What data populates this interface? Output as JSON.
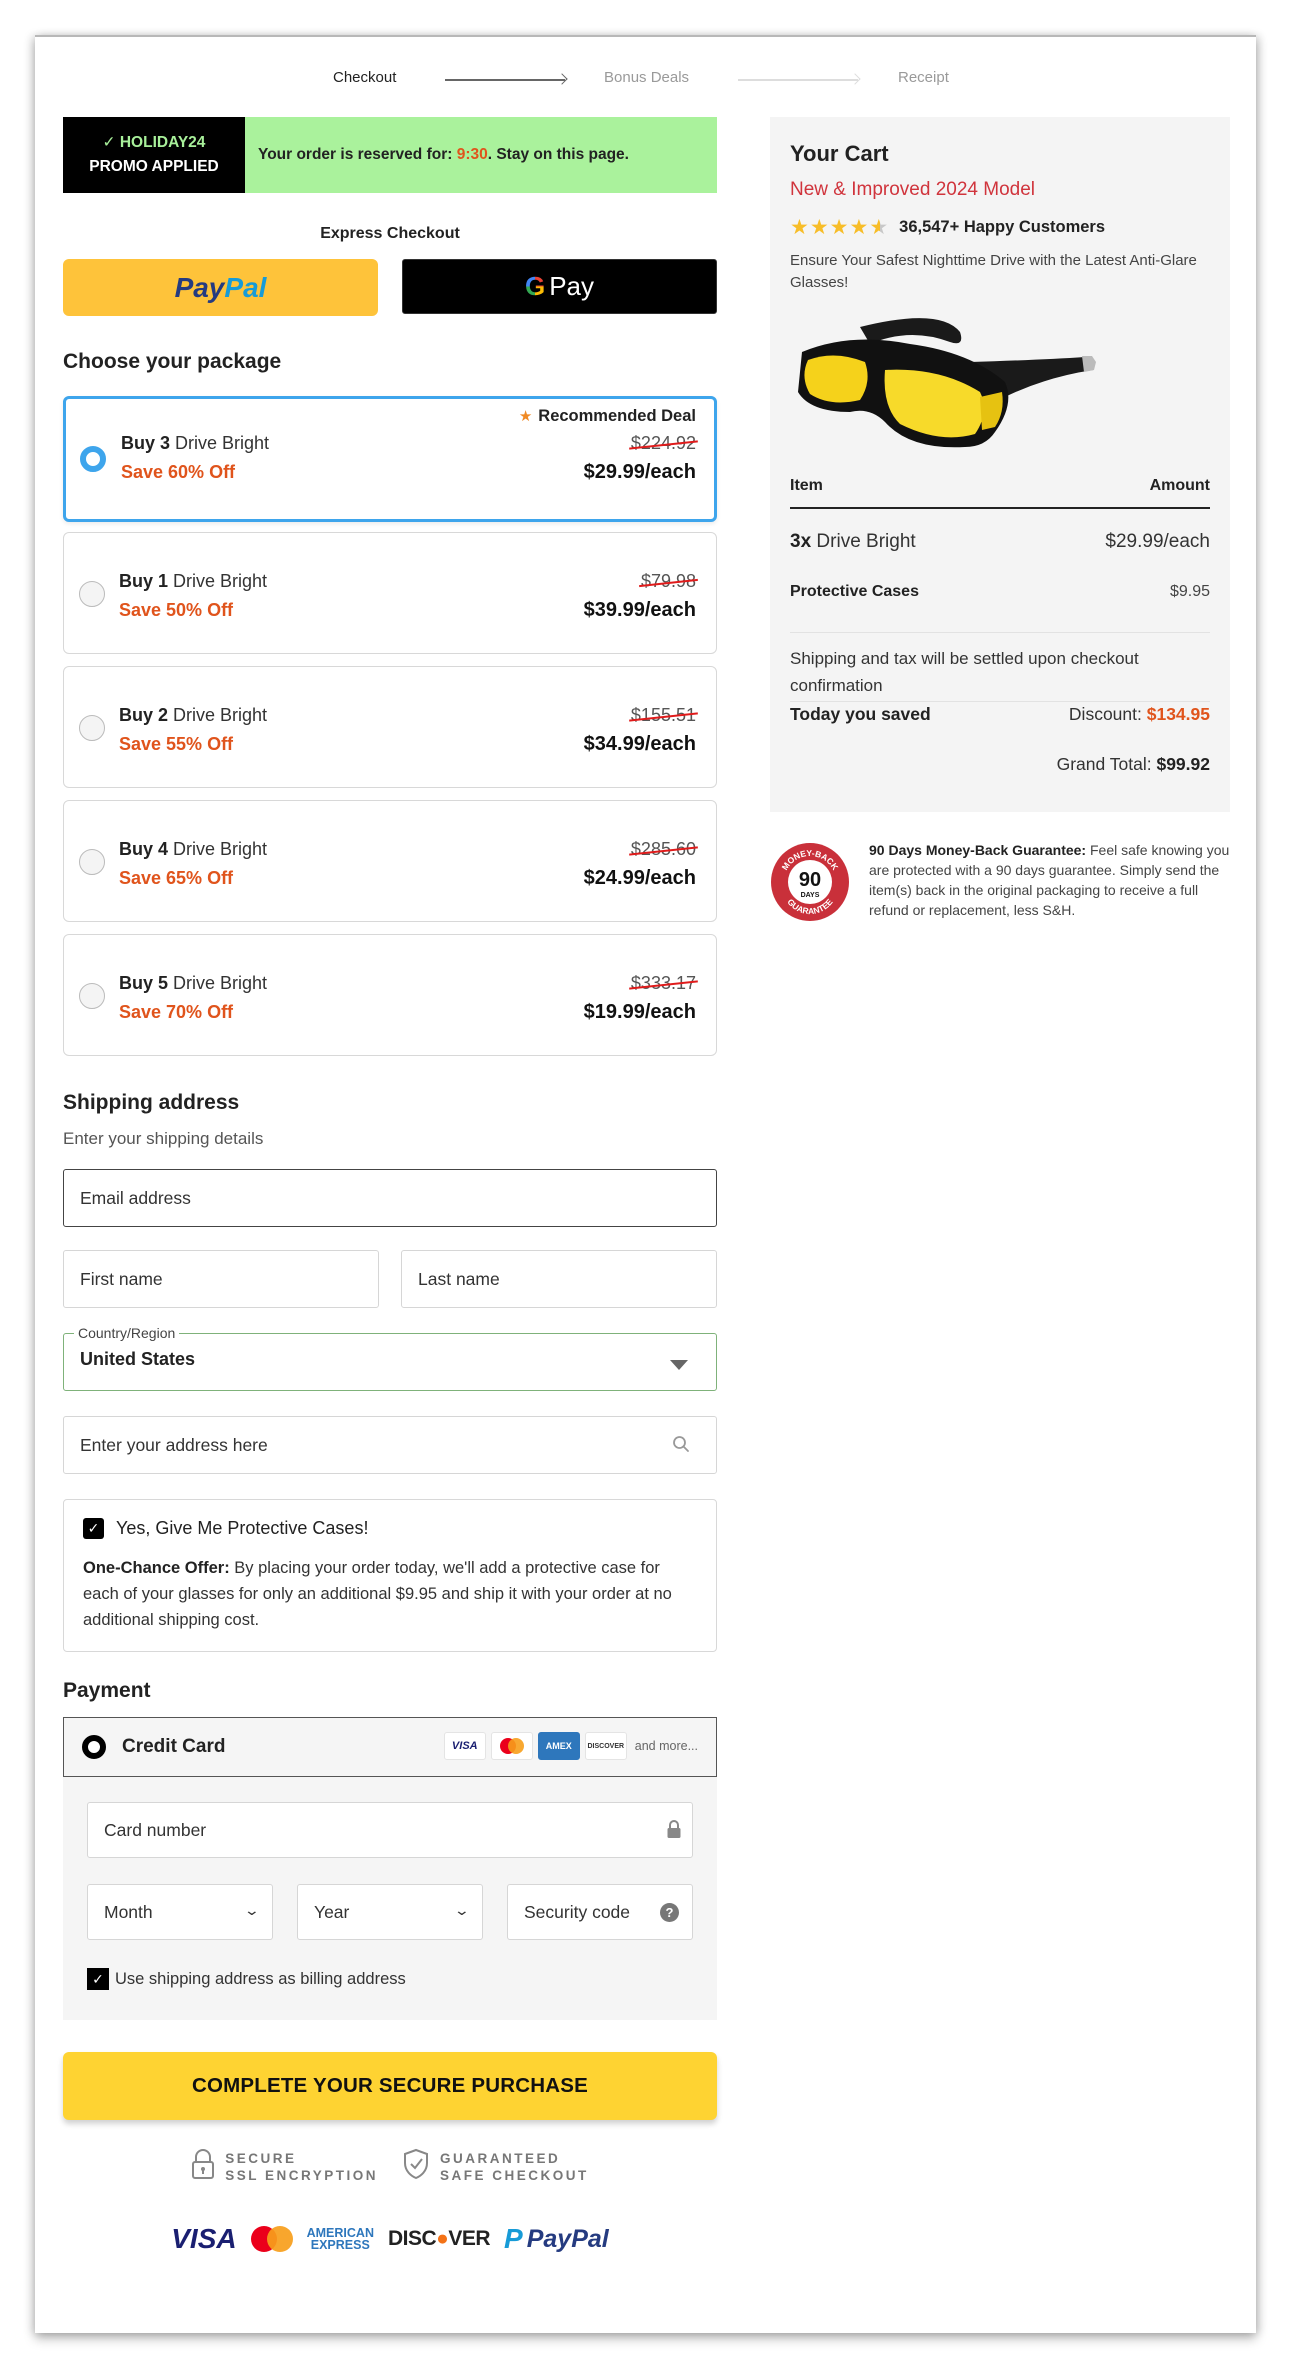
{
  "steps": [
    {
      "label": "Checkout",
      "state": "active"
    },
    {
      "label": "Bonus Deals",
      "state": "inactive"
    },
    {
      "label": "Receipt",
      "state": "inactive"
    }
  ],
  "promo": {
    "check_icon": "✓",
    "code": "HOLIDAY24",
    "applied_label": "PROMO APPLIED",
    "message_prefix": "Your order is reserved for: ",
    "timer": "9:30",
    "message_suffix": ". Stay on this page."
  },
  "express": {
    "title": "Express Checkout",
    "paypal_pay": "Pay",
    "paypal_pal": "Pal",
    "gpay_g": "G",
    "gpay_label": "Pay"
  },
  "packages": {
    "title": "Choose your package",
    "recommended_label": "Recommended Deal",
    "items": [
      {
        "qty_label": "Buy 3",
        "product": " Drive Bright",
        "save": "Save 60% Off",
        "old_price": "$224.92",
        "price": "$29.99/each",
        "selected": true,
        "recommended": true
      },
      {
        "qty_label": "Buy 1",
        "product": " Drive Bright",
        "save": "Save 50% Off",
        "old_price": "$79.98",
        "price": "$39.99/each",
        "selected": false,
        "recommended": false
      },
      {
        "qty_label": "Buy 2",
        "product": " Drive Bright",
        "save": "Save 55% Off",
        "old_price": "$155.51",
        "price": "$34.99/each",
        "selected": false,
        "recommended": false
      },
      {
        "qty_label": "Buy 4",
        "product": " Drive Bright",
        "save": "Save 65% Off",
        "old_price": "$285.60",
        "price": "$24.99/each",
        "selected": false,
        "recommended": false
      },
      {
        "qty_label": "Buy 5",
        "product": " Drive Bright",
        "save": "Save 70% Off",
        "old_price": "$333.17",
        "price": "$19.99/each",
        "selected": false,
        "recommended": false
      }
    ]
  },
  "shipping": {
    "title": "Shipping address",
    "subtitle": "Enter your shipping details",
    "email_placeholder": "Email address",
    "first_name_placeholder": "First name",
    "last_name_placeholder": "Last name",
    "country_label": "Country/Region",
    "country_value": "United States",
    "address_placeholder": "Enter your address here"
  },
  "cases_offer": {
    "checked": true,
    "label": "Yes, Give Me Protective Cases!",
    "offer_bold": "One-Chance Offer:",
    "offer_text": " By placing your order today, we'll add a protective case for each of your glasses for only an additional $9.95 and ship it with your order at no additional shipping cost."
  },
  "payment": {
    "title": "Payment",
    "method_label": "Credit Card",
    "card_logos": [
      "VISA",
      "Mastercard",
      "AMEX",
      "DISCOVER"
    ],
    "and_more": "and more...",
    "card_number_placeholder": "Card number",
    "month_placeholder": "Month",
    "year_placeholder": "Year",
    "security_placeholder": "Security code",
    "billing_checked": true,
    "billing_label": "Use shipping address as billing address"
  },
  "cta": {
    "label": "COMPLETE YOUR SECURE PURCHASE"
  },
  "trust": {
    "ssl_line1": "SECURE",
    "ssl_line2": "SSL ENCRYPTION",
    "safe_line1": "GUARANTEED",
    "safe_line2": "SAFE CHECKOUT"
  },
  "footer_logos": {
    "visa": "VISA",
    "amex_line1": "AMERICAN",
    "amex_line2": "EXPRESS",
    "discover_pre": "DISC",
    "discover_o": "●",
    "discover_post": "VER",
    "paypal": "PayPal"
  },
  "cart": {
    "title": "Your Cart",
    "model": "New & Improved 2024 Model",
    "rating": 4.5,
    "stars_full": "★★★★",
    "star_half": "★",
    "happy": "36,547+ Happy Customers",
    "description": "Ensure Your Safest Nighttime Drive with the Latest Anti-Glare Glasses!",
    "col_item": "Item",
    "col_amount": "Amount",
    "item_qty": "3x",
    "item_name": " Drive Bright",
    "item_price": "$29.99/each",
    "cases_label": "Protective Cases",
    "cases_price": "$9.95",
    "shipping_note": "Shipping and tax will be settled upon checkout confirmation",
    "saved_label": "Today you saved",
    "discount_label": "Discount: ",
    "discount_value": "$134.95",
    "grand_label": "Grand Total: ",
    "grand_value": "$99.92"
  },
  "guarantee": {
    "badge_top": "MONEY-BACK",
    "badge_num": "90",
    "badge_days": "DAYS",
    "badge_bottom": "GUARANTEE",
    "bold": "90 Days Money-Back Guarantee:",
    "text": " Feel safe knowing you are protected with a 90 days guarantee. Simply send the item(s) back in the original packaging to receive a full refund or replacement, less S&H."
  }
}
